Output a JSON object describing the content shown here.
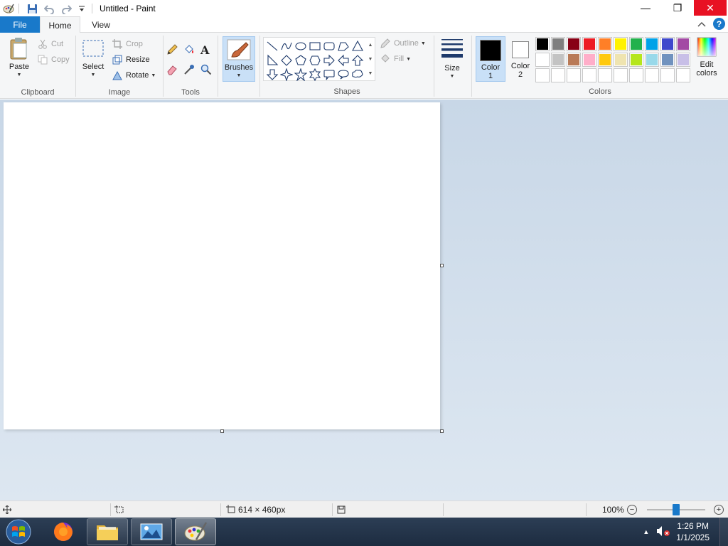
{
  "window": {
    "title": "Untitled - Paint",
    "minimize_glyph": "—",
    "restore_glyph": "❐",
    "close_glyph": "✕"
  },
  "tabs": {
    "file": "File",
    "home": "Home",
    "view": "View",
    "help_glyph": "?"
  },
  "clipboard": {
    "label": "Clipboard",
    "paste": "Paste",
    "cut": "Cut",
    "copy": "Copy"
  },
  "image": {
    "label": "Image",
    "select": "Select",
    "crop": "Crop",
    "resize": "Resize",
    "rotate": "Rotate"
  },
  "tools": {
    "label": "Tools",
    "text_glyph": "A"
  },
  "brushes": {
    "label": "Brushes"
  },
  "shapes": {
    "label": "Shapes",
    "outline": "Outline",
    "fill": "Fill",
    "items": [
      "line-shape-icon",
      "curve-shape-icon",
      "oval-shape-icon",
      "rectangle-shape-icon",
      "rounded-rectangle-shape-icon",
      "polygon-shape-icon",
      "triangle-shape-icon",
      "right-triangle-shape-icon",
      "diamond-shape-icon",
      "pentagon-shape-icon",
      "hexagon-shape-icon",
      "right-arrow-shape-icon",
      "left-arrow-shape-icon",
      "up-arrow-shape-icon",
      "down-arrow-shape-icon",
      "four-point-star-shape-icon",
      "five-point-star-shape-icon",
      "six-point-star-shape-icon",
      "rounded-callout-shape-icon",
      "oval-callout-shape-icon",
      "cloud-callout-shape-icon"
    ]
  },
  "size": {
    "label": "Size"
  },
  "colors": {
    "label": "Colors",
    "color1_line1": "Color",
    "color1_line2": "1",
    "color2_line1": "Color",
    "color2_line2": "2",
    "color1_value": "#000000",
    "color2_value": "#ffffff",
    "edit_line1": "Edit",
    "edit_line2": "colors",
    "palette": [
      "#000000",
      "#7f7f7f",
      "#880015",
      "#ed1c24",
      "#ff7f27",
      "#fff200",
      "#22b14c",
      "#00a2e8",
      "#3f48cc",
      "#a349a4",
      "#ffffff",
      "#c3c3c3",
      "#b97a57",
      "#ffaec9",
      "#ffc90e",
      "#efe4b0",
      "#b5e61d",
      "#99d9ea",
      "#7092be",
      "#c8bfe7",
      "",
      "",
      "",
      "",
      "",
      "",
      "",
      "",
      "",
      ""
    ]
  },
  "status": {
    "canvas_size": "614 × 460px",
    "zoom": "100%"
  },
  "taskbar": {
    "time": "1:26 PM",
    "date": "1/1/2025"
  }
}
